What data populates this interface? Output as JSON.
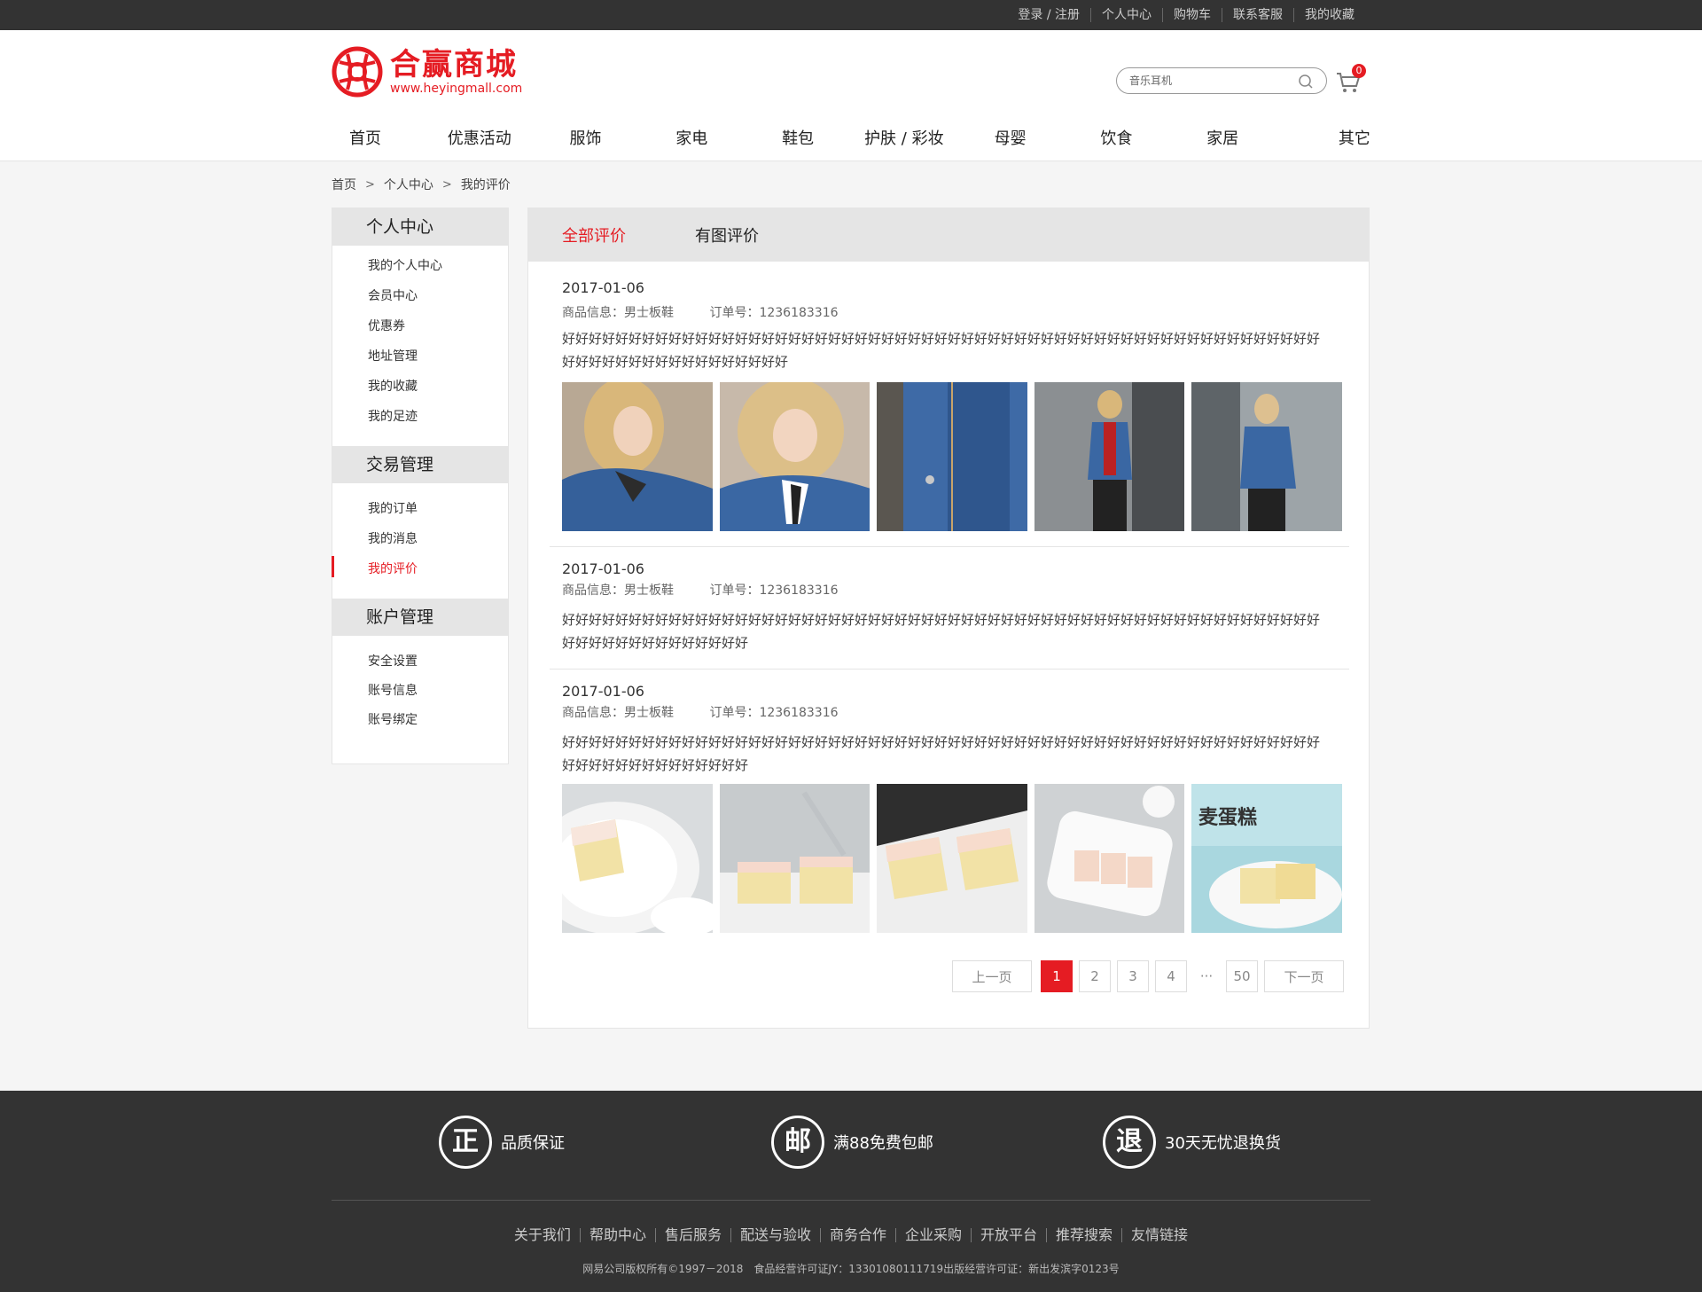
{
  "topbar": {
    "links": [
      "登录 / 注册",
      "个人中心",
      "购物车",
      "联系客服",
      "我的收藏"
    ]
  },
  "logo": {
    "name": "合赢商城",
    "url": "www.heyingmall.com"
  },
  "search": {
    "placeholder": "音乐耳机"
  },
  "cart": {
    "count": "0"
  },
  "nav": [
    "首页",
    "优惠活动",
    "服饰",
    "家电",
    "鞋包",
    "护肤 / 彩妆",
    "母婴",
    "饮食",
    "家居",
    "其它"
  ],
  "breadcrumb": [
    "首页",
    "个人中心",
    "我的评价"
  ],
  "sidebar": {
    "groups": [
      {
        "title": "个人中心",
        "items": [
          "我的个人中心",
          "会员中心",
          "优惠券",
          "地址管理",
          "我的收藏",
          "我的足迹"
        ]
      },
      {
        "title": "交易管理",
        "items": [
          "我的订单",
          "我的消息",
          "我的评价"
        ]
      },
      {
        "title": "账户管理",
        "items": [
          "安全设置",
          "账号信息",
          "账号绑定"
        ]
      }
    ],
    "active": "我的评价"
  },
  "tabs": {
    "all": "全部评价",
    "with_images": "有图评价"
  },
  "reviews": [
    {
      "date": "2017-01-06",
      "product_label": "商品信息：",
      "product": "男士板鞋",
      "order_label": "订单号：",
      "order": "1236183316",
      "text": "好好好好好好好好好好好好好好好好好好好好好好好好好好好好好好好好好好好好好好好好好好好好好好好好好好好好好好好好好好好好好好好好好好好好好好好好好好"
    },
    {
      "date": "2017-01-06",
      "product_label": "商品信息：",
      "product": "男士板鞋",
      "order_label": "订单号：",
      "order": "1236183316",
      "text": "好好好好好好好好好好好好好好好好好好好好好好好好好好好好好好好好好好好好好好好好好好好好好好好好好好好好好好好好好好好好好好好好好好好好好好好"
    },
    {
      "date": "2017-01-06",
      "product_label": "商品信息：",
      "product": "男士板鞋",
      "order_label": "订单号：",
      "order": "1236183316",
      "text": "好好好好好好好好好好好好好好好好好好好好好好好好好好好好好好好好好好好好好好好好好好好好好好好好好好好好好好好好好好好好好好好好好好好好好好好"
    }
  ],
  "pagination": {
    "prev": "上一页",
    "pages": [
      "1",
      "2",
      "3",
      "4"
    ],
    "ellipsis": "···",
    "last": "50",
    "next": "下一页",
    "current": "1"
  },
  "footer": {
    "features": [
      {
        "icon": "正",
        "label": "品质保证"
      },
      {
        "icon": "邮",
        "label": "满88免费包邮"
      },
      {
        "icon": "退",
        "label": "30天无忧退换货"
      }
    ],
    "links": [
      "关于我们",
      "帮助中心",
      "售后服务",
      "配送与验收",
      "商务合作",
      "企业采购",
      "开放平台",
      "推荐搜索",
      "友情链接"
    ],
    "copyright": "网易公司版权所有©1997－2018　食品经营许可证JY：13301080111719出版经营许可证：新出发滨字0123号"
  },
  "colors": {
    "accent": "#e51c23",
    "topbar": "#333333",
    "footer": "#333333",
    "tab_bg": "#e5e5e5"
  }
}
